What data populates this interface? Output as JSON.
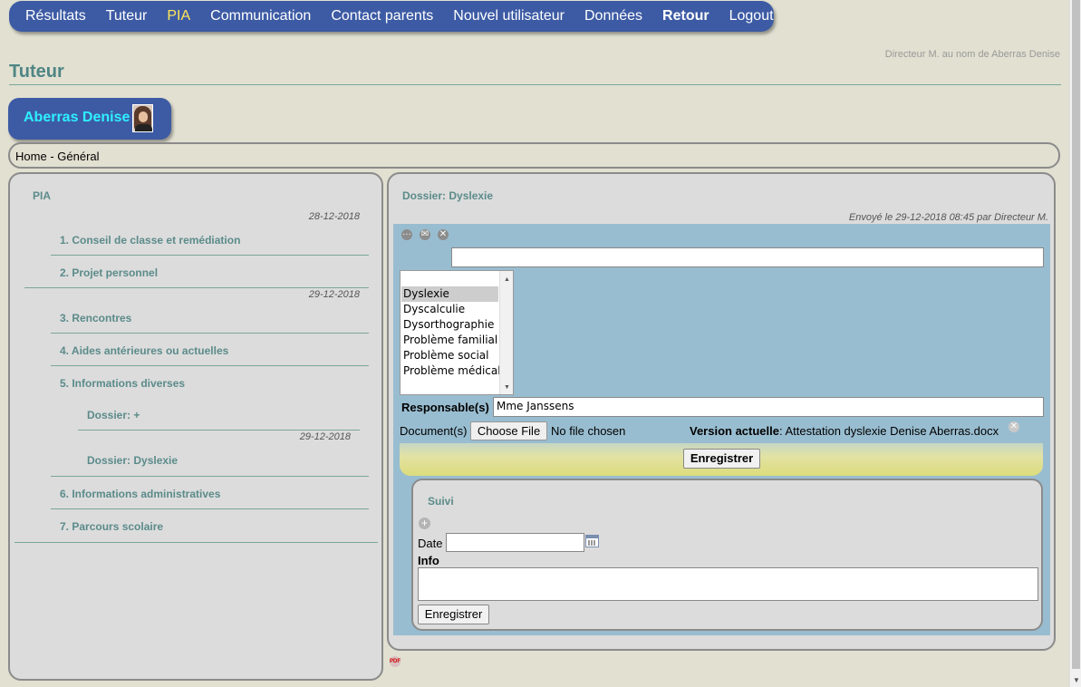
{
  "nav": {
    "items": [
      {
        "label": "Résultats",
        "name": "nav-resultats"
      },
      {
        "label": "Tuteur",
        "name": "nav-tuteur"
      },
      {
        "label": "PIA",
        "name": "nav-pia"
      },
      {
        "label": "Communication",
        "name": "nav-communication"
      },
      {
        "label": "Contact parents",
        "name": "nav-contact-parents"
      },
      {
        "label": "Nouvel utilisateur",
        "name": "nav-nouvel-utilisateur"
      },
      {
        "label": "Données",
        "name": "nav-donnees"
      },
      {
        "label": "Retour",
        "name": "nav-retour"
      },
      {
        "label": "Logout",
        "name": "nav-logout"
      }
    ],
    "active": "PIA",
    "bold": "Retour",
    "bg_color": "#3d5ba4",
    "active_color": "#ffe75a"
  },
  "header": {
    "user_note": "Directeur M. au nom de Aberras Denise",
    "page_title": "Tuteur"
  },
  "student": {
    "name": "Aberras Denise",
    "name_color": "#2ef0ff"
  },
  "breadcrumb": {
    "home": "Home",
    "separator": "-",
    "current": "Général"
  },
  "left_panel": {
    "heading": "PIA",
    "date1": "28-12-2018",
    "item1": "1. Conseil de classe et remédiation",
    "item2": "2. Projet personnel",
    "date2": "29-12-2018",
    "item3": "3. Rencontres",
    "item4": "4. Aides antérieures ou actuelles",
    "item5": "5. Informations diverses",
    "sub1": "Dossier: +",
    "date3": "29-12-2018",
    "sub2": "Dossier: Dyslexie",
    "item6": "6. Informations administratives",
    "item7": "7. Parcours scolaire"
  },
  "right_panel": {
    "title": "Dossier: Dyslexie",
    "sent": "Envoyé le 29-12-2018 08:45 par Directeur M.",
    "categories": [
      "",
      "Dyslexie",
      "Dyscalculie",
      "Dysorthographie",
      "Problème familial",
      "Problème social",
      "Problème médical"
    ],
    "selected_category": "Dyslexie",
    "responsable_label": "Responsable(s)",
    "responsable_value": "Mme Janssens",
    "documents_label": "Document(s)",
    "choose_file": "Choose File",
    "no_file": "No file chosen",
    "version_label": "Version actuelle",
    "version_file": "Attestation dyslexie Denise Aberras.docx",
    "save_label": "Enregistrer",
    "suivi": {
      "title": "Suivi",
      "date_label": "Date",
      "info_label": "Info",
      "save_label": "Enregistrer"
    }
  },
  "icons": {
    "pdf": "PDF"
  }
}
